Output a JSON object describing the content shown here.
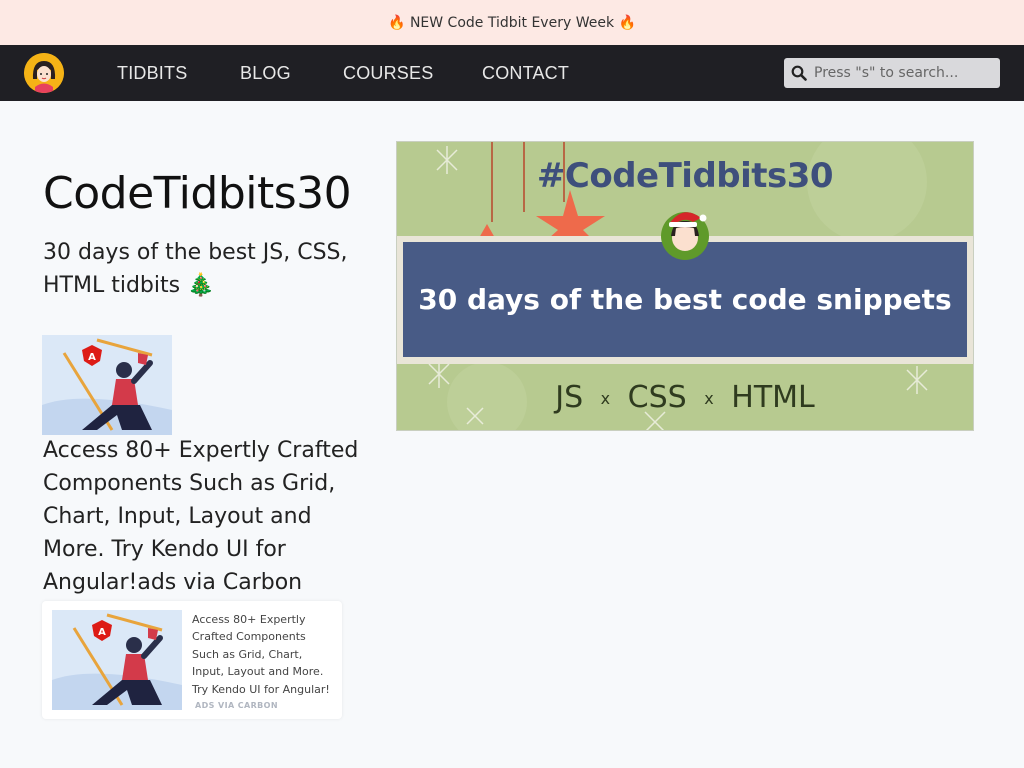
{
  "banner": {
    "text": "🔥 NEW Code Tidbit Every Week 🔥"
  },
  "nav": {
    "links": [
      "TIDBITS",
      "BLOG",
      "COURSES",
      "CONTACT"
    ],
    "search_placeholder": "Press \"s\" to search..."
  },
  "main": {
    "title": "CodeTidbits30",
    "subtitle": "30 days of the best JS, CSS, HTML tidbits 🎄",
    "ad_text": "Access 80+ Expertly Crafted Components Such as Grid, Chart, Input, Layout and More. Try Kendo UI for Angular!ads via Carbon"
  },
  "carbon_ad": {
    "text": "Access 80+ Expertly Crafted Components Such as Grid, Chart, Input, Layout and More. Try Kendo UI for Angular!",
    "via": "ADS VIA CARBON"
  },
  "hero": {
    "hashtag": "#CodeTidbits30",
    "tagline": "30 days of the best code snippets",
    "lang1": "JS",
    "lang2": "CSS",
    "lang3": "HTML",
    "separator": "x"
  },
  "colors": {
    "banner_bg": "#fde9e4",
    "nav_bg": "#1f1f24",
    "hero_green": "#b5c98e",
    "hero_blue": "#485b86",
    "logo_yellow": "#f5b316"
  }
}
